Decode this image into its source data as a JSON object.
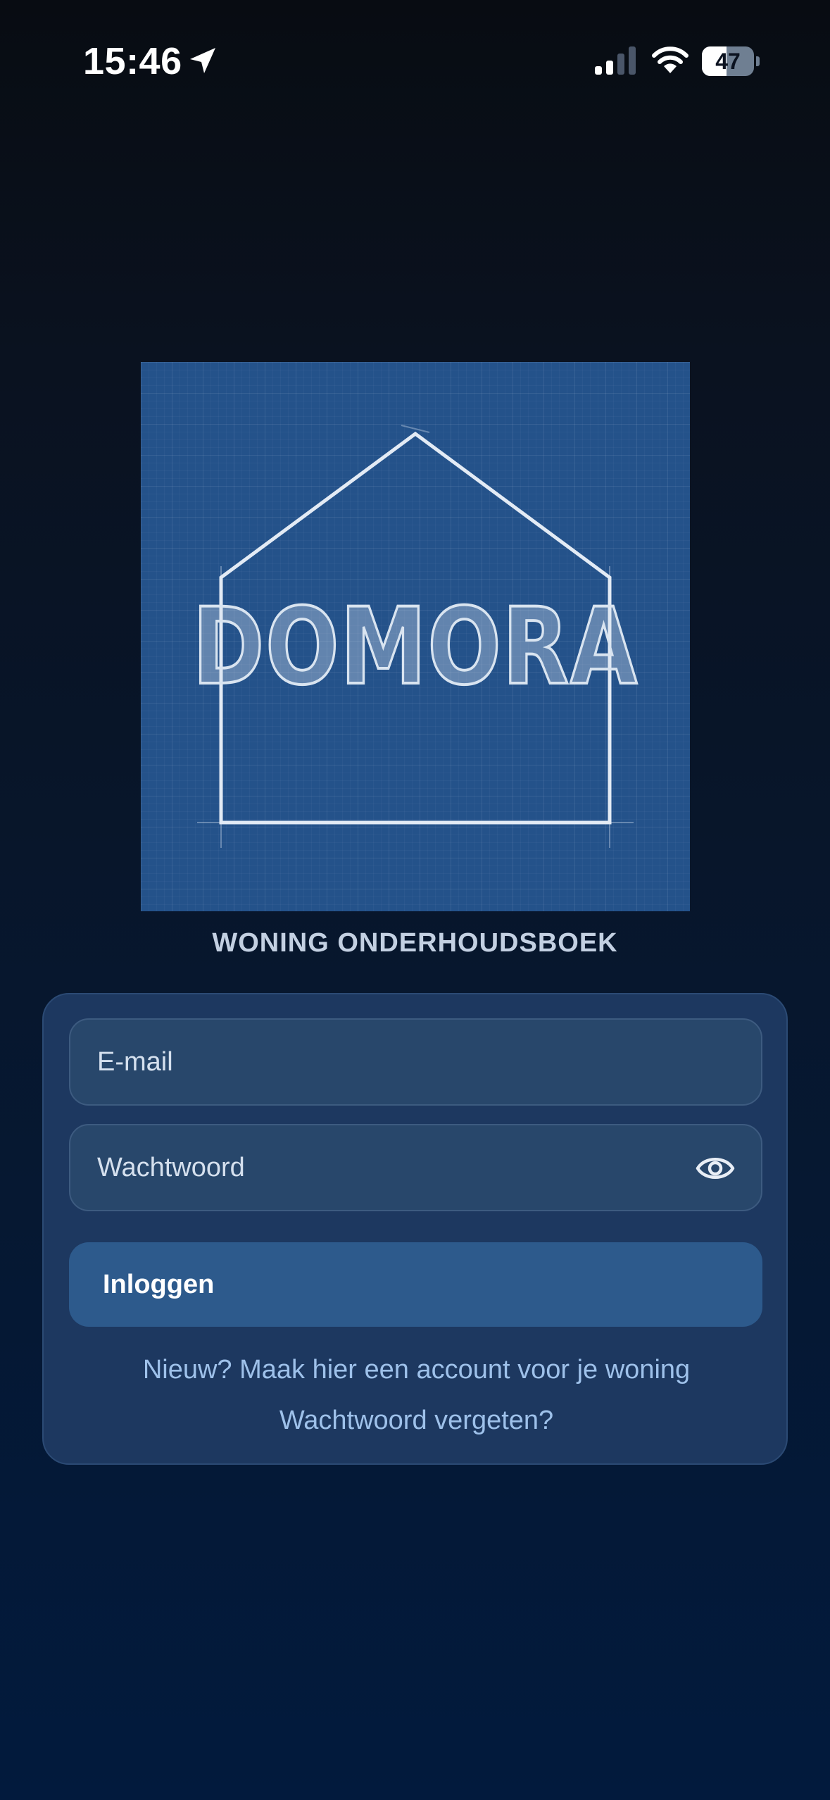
{
  "status_bar": {
    "time": "15:46",
    "battery_percent": 47,
    "battery_label": "47",
    "icons": [
      "location-arrow-icon",
      "cellular-signal-icon",
      "wifi-icon",
      "battery-icon"
    ]
  },
  "logo": {
    "wordmark": "DOMORA",
    "icon": "house-outline-icon"
  },
  "subtitle": "WONING ONDERHOUDSBOEK",
  "login_form": {
    "email_placeholder": "E-mail",
    "password_placeholder": "Wachtwoord",
    "password_toggle_icon": "eye-icon",
    "login_label": "Inloggen",
    "register_link": "Nieuw? Maak hier een account voor je woning",
    "forgot_link": "Wachtwoord vergeten?"
  },
  "colors": {
    "background_top": "#080c12",
    "background_bottom": "#021a3d",
    "card": "#1d3860",
    "input": "#28476b",
    "button": "#2d5a8c",
    "link": "#9ec1ea",
    "logo_background": "#24528a"
  }
}
